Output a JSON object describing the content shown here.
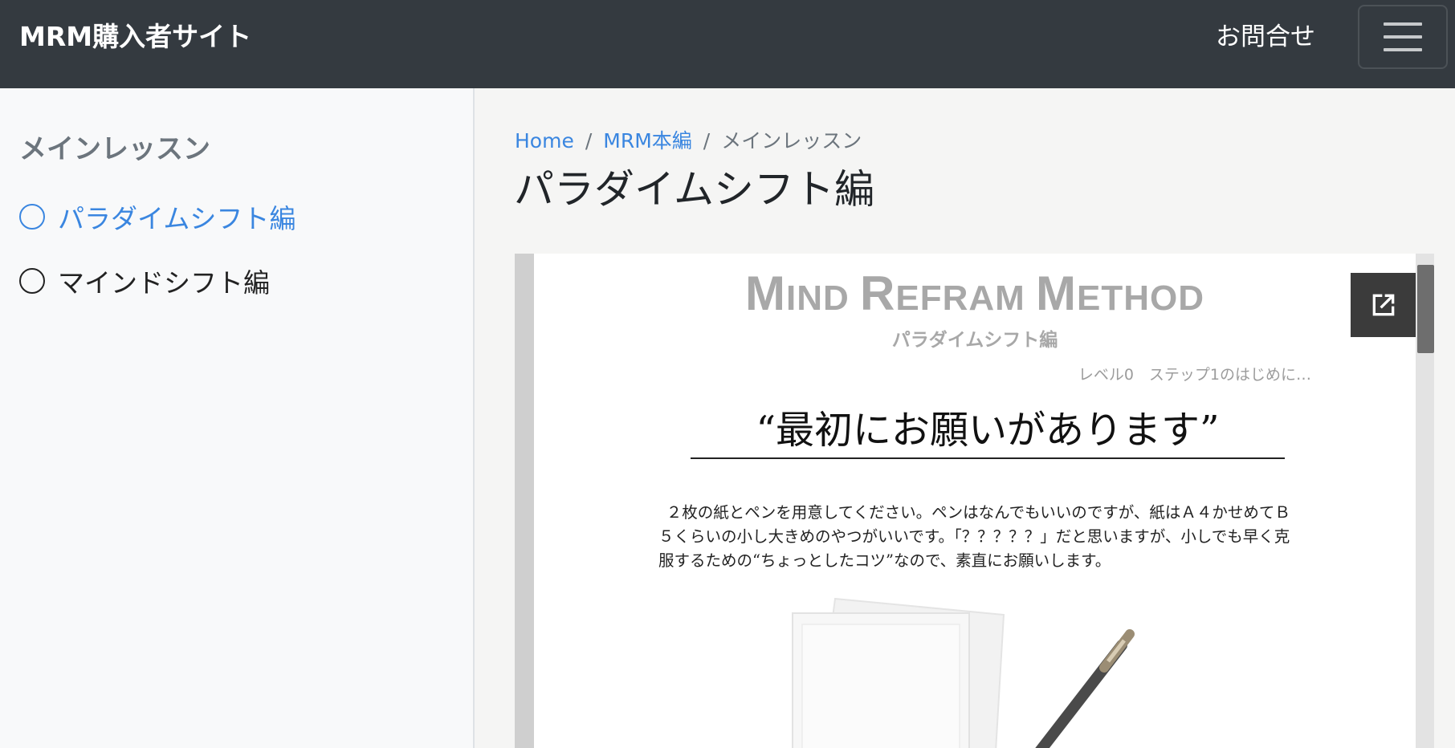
{
  "navbar": {
    "brand": "MRM購入者サイト",
    "contact": "お問合せ",
    "menu_icon": "hamburger-menu-icon"
  },
  "sidebar": {
    "heading": "メインレッスン",
    "items": [
      {
        "label": "パラダイムシフト編",
        "active": true
      },
      {
        "label": "マインドシフト編",
        "active": false
      }
    ]
  },
  "breadcrumb": {
    "home": "Home",
    "section": "MRM本編",
    "current": "メインレッスン",
    "separator": "/"
  },
  "page_title": "パラダイムシフト編",
  "document": {
    "brand_parts": [
      {
        "big": "M",
        "small": "IND"
      },
      {
        "big": "R",
        "small": "EFRAM"
      },
      {
        "big": "M",
        "small": "ETHOD"
      }
    ],
    "subtitle": "パラダイムシフト編",
    "step": "レベル0　ステップ1のはじめに…",
    "heading": "“最初にお願いがあります”",
    "body": "２枚の紙とペンを用意してください。ペンはなんでもいいのですが、紙はＡ４かせめてＢ５くらいの小し大きめのやつがいいです。「？？？？？」だと思いますが、小しでも早く克服するための“ちょっとしたコツ”なので、素直にお願いします。",
    "popout_icon": "open-in-new-icon"
  },
  "colors": {
    "navbar_bg": "#343a40",
    "link": "#3a86e0",
    "sidebar_bg": "#f8f9fa"
  }
}
